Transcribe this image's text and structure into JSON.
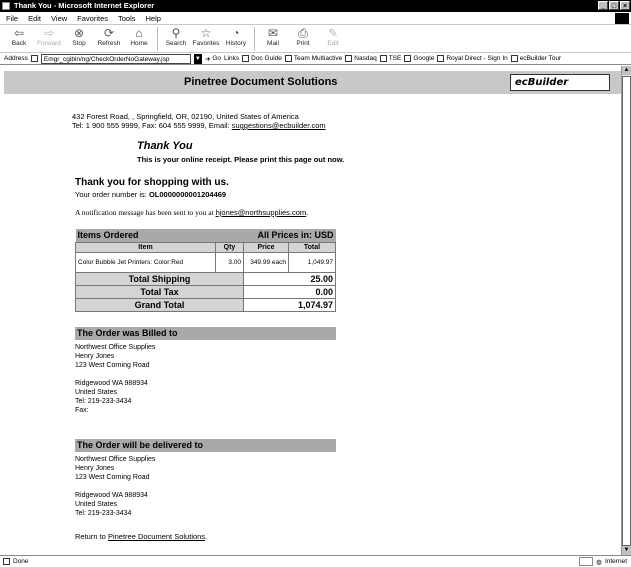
{
  "window": {
    "title": "Thank You - Microsoft Internet Explorer",
    "controls": [
      "_",
      "□",
      "×"
    ]
  },
  "menu": [
    "File",
    "Edit",
    "View",
    "Favorites",
    "Tools",
    "Help"
  ],
  "toolbar": [
    {
      "label": "Back",
      "icon": "back-arrow",
      "glyph": "⇦",
      "enabled": true
    },
    {
      "label": "Forward",
      "icon": "forward-arrow",
      "glyph": "⇨",
      "enabled": false
    },
    {
      "label": "Stop",
      "icon": "stop-icon",
      "glyph": "⊗",
      "enabled": true
    },
    {
      "label": "Refresh",
      "icon": "refresh-icon",
      "glyph": "⟳",
      "enabled": true
    },
    {
      "label": "Home",
      "icon": "home-icon",
      "glyph": "⌂",
      "enabled": true
    },
    {
      "label": "Search",
      "icon": "search-icon",
      "glyph": "⚲",
      "enabled": true
    },
    {
      "label": "Favorites",
      "icon": "favorites-icon",
      "glyph": "☆",
      "enabled": true
    },
    {
      "label": "History",
      "icon": "history-icon",
      "glyph": "◔",
      "enabled": true
    },
    {
      "label": "Mail",
      "icon": "mail-icon",
      "glyph": "✉",
      "enabled": true
    },
    {
      "label": "Print",
      "icon": "print-icon",
      "glyph": "⎙",
      "enabled": true
    },
    {
      "label": "Edit",
      "icon": "edit-icon",
      "glyph": "✎",
      "enabled": false
    }
  ],
  "address": {
    "label": "Address",
    "url": "Emgr_cgibin/ng/CheckOrderNoGateway.jsp",
    "go": "Go",
    "links_label": "Links",
    "links": [
      "Doc Guide",
      "Team Multiactive",
      "Nasdaq",
      "TSE",
      "Google",
      "Royal Direct - Sign In",
      "ecBuilder Tour"
    ]
  },
  "status": {
    "left": "Done",
    "zone": "Internet"
  },
  "page": {
    "site_title": "Pinetree Document Solutions",
    "logo_text": "ecBuilder",
    "address_line": "432 Forest Road, , Springfield, OR, 02190, United States of America",
    "contact_prefix": "Tel: 1 900 555 9999, Fax: 604 555 9999, Email: ",
    "contact_email": "suggestions@ecbuilder.com",
    "thank_you": "Thank You",
    "receipt_note": "This is your online receipt. Please print this page out now.",
    "shop_heading": "Thank you for shopping with us.",
    "order_prefix": "Your order number is: ",
    "order_number": "OL0000000001204469",
    "notify_prefix": "A notification message has been sent to you at ",
    "notify_email": "hjones@northsupplies.com",
    "notify_suffix": ".",
    "items_heading": "Items Ordered",
    "currency_note": "All Prices in: USD",
    "columns": [
      "Item",
      "Qty",
      "Price",
      "Total"
    ],
    "items": [
      {
        "name": "Color Bubble Jet Printers: Color:Red",
        "qty": "3.00",
        "price": "349.99 each",
        "total": "1,049.97"
      }
    ],
    "totals": [
      {
        "label": "Total Shipping",
        "value": "25.00"
      },
      {
        "label": "Total Tax",
        "value": "0.00"
      },
      {
        "label": "Grand Total",
        "value": "1,074.97"
      }
    ],
    "billed_heading": "The Order was Billed to",
    "billed_lines": [
      "Northwest Office Supplies",
      "Henry Jones",
      "123 West Corning Road",
      "",
      "Ridgewood WA 988934",
      "United States",
      "Tel: 219-233-3434",
      "Fax:"
    ],
    "delivered_heading": "The Order will be delivered to",
    "delivered_lines": [
      "Northwest Office Supplies",
      "Henry Jones",
      "123 West Corning Road",
      "",
      "Ridgewood WA 988934",
      "United States",
      "Tel: 219-233-3434"
    ],
    "return_prefix": "Return to ",
    "return_link": "Pinetree Document Solutions",
    "return_suffix": "."
  }
}
